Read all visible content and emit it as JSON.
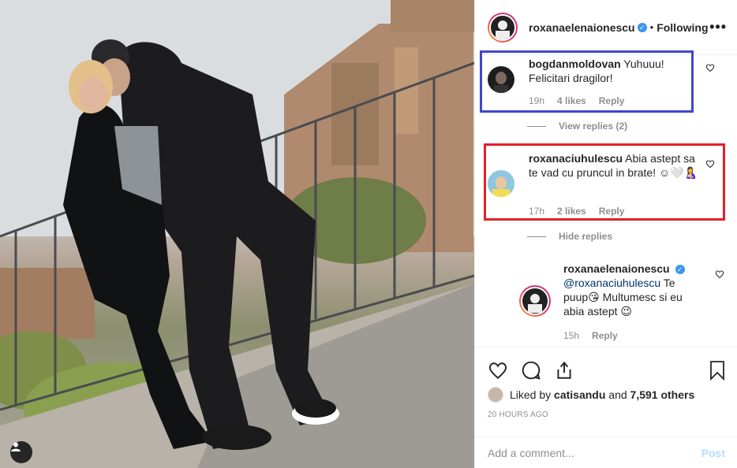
{
  "post": {
    "author": "roxanaelenaionescu",
    "following_label": "Following",
    "separator": "•",
    "more_label": "•••",
    "verified_glyph": "✓"
  },
  "comments": [
    {
      "username": "bogdanmoldovan",
      "text": "Yuhuuu! Felicitari dragilor!",
      "time": "19h",
      "likes": "4 likes",
      "reply_label": "Reply",
      "view_replies": "View replies (2)"
    },
    {
      "username": "roxanaciuhulescu",
      "text": "Abia astept sa te vad cu pruncul in brate! ☺🤍🤱",
      "time": "17h",
      "likes": "2 likes",
      "reply_label": "Reply",
      "more": "...",
      "hide_replies": "Hide replies"
    }
  ],
  "reply": {
    "username": "roxanaelenaionescu",
    "mention": "@roxanaciuhulescu",
    "text": " Te puup😘 Multumesc si eu abia astept 😉",
    "time": "15h",
    "reply_label": "Reply"
  },
  "actions": {
    "liked_by_prefix": "Liked by",
    "liked_by_user": "catisandu",
    "liked_by_joiner": "and",
    "liked_by_others": "7,591 others",
    "time_ago": "20 HOURS AGO"
  },
  "composer": {
    "placeholder": "Add a comment...",
    "post_label": "Post"
  },
  "icons": [
    "heart-icon",
    "comment-icon",
    "share-icon",
    "bookmark-icon",
    "user-tag-icon",
    "more-options-icon",
    "verified-icon"
  ],
  "colors": {
    "verified": "#3897f0",
    "highlight_blue": "#3f48cc",
    "highlight_red": "#e3202a",
    "muted_text": "#8e8e8e",
    "post_disabled": "#b2dffc"
  }
}
